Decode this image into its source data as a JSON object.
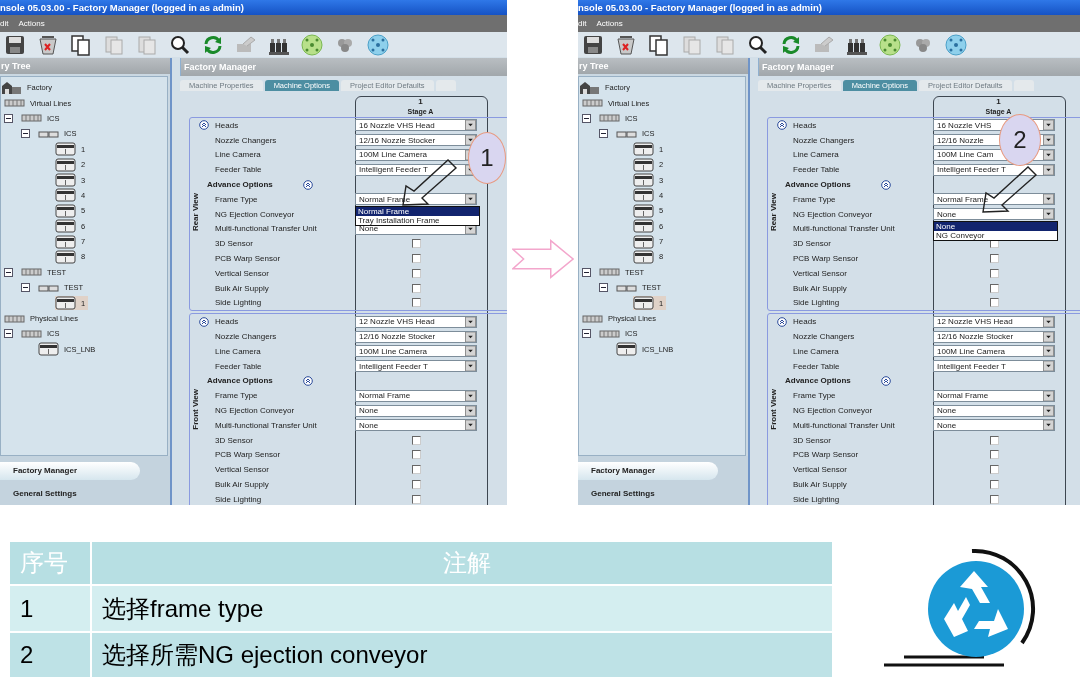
{
  "screens": [
    {
      "title": "nsole 05.03.00 - Factory Manager (logged in as admin)",
      "menu": [
        "dit",
        "Actions"
      ],
      "tree_title": "ry Tree",
      "tree": [
        {
          "label": "Factory",
          "selected": false,
          "children": [
            {
              "label": "Virtual Lines",
              "selected": false,
              "children": [
                {
                  "label": "ICS",
                  "selected": false,
                  "children": [
                    {
                      "label": "ICS",
                      "selected": false,
                      "children": [
                        {
                          "label": "1",
                          "selected": false
                        },
                        {
                          "label": "2",
                          "selected": false
                        },
                        {
                          "label": "3",
                          "selected": false
                        },
                        {
                          "label": "4",
                          "selected": false
                        },
                        {
                          "label": "5",
                          "selected": false
                        },
                        {
                          "label": "6",
                          "selected": false
                        },
                        {
                          "label": "7",
                          "selected": false
                        },
                        {
                          "label": "8",
                          "selected": false
                        }
                      ]
                    }
                  ]
                },
                {
                  "label": "TEST",
                  "selected": false,
                  "children": [
                    {
                      "label": "TEST",
                      "selected": false,
                      "children": [
                        {
                          "label": "1",
                          "selected": true
                        }
                      ]
                    }
                  ]
                }
              ]
            },
            {
              "label": "Physical Lines",
              "selected": false,
              "children": [
                {
                  "label": "ICS",
                  "selected": false,
                  "children": [
                    {
                      "label": "ICS_LNB",
                      "selected": false
                    }
                  ]
                }
              ]
            }
          ]
        }
      ],
      "nav": [
        {
          "label": "Factory Manager",
          "selected": true
        },
        {
          "label": "General Settings",
          "selected": false
        }
      ],
      "panel_title": "Factory Manager",
      "tabs": [
        {
          "label": "Machine Properties",
          "selected": false
        },
        {
          "label": "Machine Options",
          "selected": true
        },
        {
          "label": "Project Editor Defaults",
          "selected": false
        }
      ],
      "stage": {
        "number": "1",
        "name": "Stage A"
      },
      "groups": [
        {
          "label": "Rear View",
          "rows": [
            {
              "kind": "select",
              "label": "Heads",
              "value": "16 Nozzle VHS Head"
            },
            {
              "kind": "select",
              "label": "Nozzle Changers",
              "value": "12/16 Nozzle Stocker"
            },
            {
              "kind": "select",
              "label": "Line Camera",
              "value": "100M Line Camera"
            },
            {
              "kind": "select",
              "label": "Feeder Table",
              "value": "Intelligent Feeder T"
            },
            {
              "kind": "section",
              "label": "Advance Options"
            },
            {
              "kind": "select",
              "label": "Frame Type",
              "value": "Normal Frame",
              "popup": [
                {
                  "label": "Normal Frame",
                  "selected": true
                },
                {
                  "label": "Tray Installation Frame",
                  "selected": false
                }
              ]
            },
            {
              "kind": "select",
              "label": "NG Ejection Conveyor"
            },
            {
              "kind": "select",
              "label": "Multi-functional Transfer Unit",
              "value": "None"
            },
            {
              "kind": "check",
              "label": "3D Sensor",
              "checked": false
            },
            {
              "kind": "check",
              "label": "PCB Warp Sensor",
              "checked": false
            },
            {
              "kind": "check",
              "label": "Vertical Sensor",
              "checked": false
            },
            {
              "kind": "check",
              "label": "Bulk Air Supply",
              "checked": false
            },
            {
              "kind": "check",
              "label": "Side Lighting",
              "checked": false
            }
          ]
        },
        {
          "label": "Front View",
          "rows": [
            {
              "kind": "select",
              "label": "Heads",
              "value": "12 Nozzle VHS Head"
            },
            {
              "kind": "select",
              "label": "Nozzle Changers",
              "value": "12/16 Nozzle Stocker"
            },
            {
              "kind": "select",
              "label": "Line Camera",
              "value": "100M Line Camera"
            },
            {
              "kind": "select",
              "label": "Feeder Table",
              "value": "Intelligent Feeder T"
            },
            {
              "kind": "section",
              "label": "Advance Options"
            },
            {
              "kind": "select",
              "label": "Frame Type",
              "value": "Normal Frame"
            },
            {
              "kind": "select",
              "label": "NG Ejection Conveyor",
              "value": "None"
            },
            {
              "kind": "select",
              "label": "Multi-functional Transfer Unit",
              "value": "None"
            },
            {
              "kind": "check",
              "label": "3D Sensor",
              "checked": false
            },
            {
              "kind": "check",
              "label": "PCB Warp Sensor",
              "checked": false
            },
            {
              "kind": "check",
              "label": "Vertical Sensor",
              "checked": false
            },
            {
              "kind": "check",
              "label": "Bulk Air Supply",
              "checked": false
            },
            {
              "kind": "check",
              "label": "Side Lighting",
              "checked": false
            }
          ]
        }
      ],
      "callout": "1"
    },
    {
      "title": "nsole 05.03.00 - Factory Manager (logged in as admin)",
      "menu": [
        "dit",
        "Actions"
      ],
      "tree_title": "ry Tree",
      "tree": [
        {
          "label": "Factory",
          "selected": false,
          "children": [
            {
              "label": "Virtual Lines",
              "selected": false,
              "children": [
                {
                  "label": "ICS",
                  "selected": false,
                  "children": [
                    {
                      "label": "ICS",
                      "selected": false,
                      "children": [
                        {
                          "label": "1",
                          "selected": false
                        },
                        {
                          "label": "2",
                          "selected": false
                        },
                        {
                          "label": "3",
                          "selected": false
                        },
                        {
                          "label": "4",
                          "selected": false
                        },
                        {
                          "label": "5",
                          "selected": false
                        },
                        {
                          "label": "6",
                          "selected": false
                        },
                        {
                          "label": "7",
                          "selected": false
                        },
                        {
                          "label": "8",
                          "selected": false
                        }
                      ]
                    }
                  ]
                },
                {
                  "label": "TEST",
                  "selected": false,
                  "children": [
                    {
                      "label": "TEST",
                      "selected": false,
                      "children": [
                        {
                          "label": "1",
                          "selected": true
                        }
                      ]
                    }
                  ]
                }
              ]
            },
            {
              "label": "Physical Lines",
              "selected": false,
              "children": [
                {
                  "label": "ICS",
                  "selected": false,
                  "children": [
                    {
                      "label": "ICS_LNB",
                      "selected": false
                    }
                  ]
                }
              ]
            }
          ]
        }
      ],
      "nav": [
        {
          "label": "Factory Manager",
          "selected": true
        },
        {
          "label": "General Settings",
          "selected": false
        }
      ],
      "panel_title": "Factory Manager",
      "tabs": [
        {
          "label": "Machine Properties",
          "selected": false
        },
        {
          "label": "Machine Options",
          "selected": true
        },
        {
          "label": "Project Editor Defaults",
          "selected": false
        }
      ],
      "stage": {
        "number": "1",
        "name": "Stage A"
      },
      "groups": [
        {
          "label": "Rear View",
          "rows": [
            {
              "kind": "select",
              "label": "Heads",
              "value": "16 Nozzle VHS"
            },
            {
              "kind": "select",
              "label": "Nozzle Changers",
              "value": "12/16 Nozzle"
            },
            {
              "kind": "select",
              "label": "Line Camera",
              "value": "100M Line Cam"
            },
            {
              "kind": "select",
              "label": "Feeder Table",
              "value": "Intelligent Feeder T"
            },
            {
              "kind": "section",
              "label": "Advance Options"
            },
            {
              "kind": "select",
              "label": "Frame Type",
              "value": "Normal Frame"
            },
            {
              "kind": "select",
              "label": "NG Ejection Conveyor",
              "value": "None",
              "popup": [
                {
                  "label": "None",
                  "selected": true
                },
                {
                  "label": "NG Conveyor",
                  "selected": false
                }
              ]
            },
            {
              "kind": "select",
              "label": "Multi-functional Transfer Unit"
            },
            {
              "kind": "check",
              "label": "3D Sensor",
              "checked": false
            },
            {
              "kind": "check",
              "label": "PCB Warp Sensor",
              "checked": false
            },
            {
              "kind": "check",
              "label": "Vertical Sensor",
              "checked": false
            },
            {
              "kind": "check",
              "label": "Bulk Air Supply",
              "checked": false
            },
            {
              "kind": "check",
              "label": "Side Lighting",
              "checked": false
            }
          ]
        },
        {
          "label": "Front View",
          "rows": [
            {
              "kind": "select",
              "label": "Heads",
              "value": "12 Nozzle VHS Head"
            },
            {
              "kind": "select",
              "label": "Nozzle Changers",
              "value": "12/16 Nozzle Stocker"
            },
            {
              "kind": "select",
              "label": "Line Camera",
              "value": "100M Line Camera"
            },
            {
              "kind": "select",
              "label": "Feeder Table",
              "value": "Intelligent Feeder T"
            },
            {
              "kind": "section",
              "label": "Advance Options"
            },
            {
              "kind": "select",
              "label": "Frame Type",
              "value": "Normal Frame"
            },
            {
              "kind": "select",
              "label": "NG Ejection Conveyor",
              "value": "None"
            },
            {
              "kind": "select",
              "label": "Multi-functional Transfer Unit",
              "value": "None"
            },
            {
              "kind": "check",
              "label": "3D Sensor",
              "checked": false
            },
            {
              "kind": "check",
              "label": "PCB Warp Sensor",
              "checked": false
            },
            {
              "kind": "check",
              "label": "Vertical Sensor",
              "checked": false
            },
            {
              "kind": "check",
              "label": "Bulk Air Supply",
              "checked": false
            },
            {
              "kind": "check",
              "label": "Side Lighting",
              "checked": false
            }
          ]
        }
      ],
      "callout": "2"
    }
  ],
  "table": {
    "columns": [
      "序号",
      "注解"
    ],
    "rows": [
      [
        "1",
        "选择frame type"
      ],
      [
        "2",
        "选择所需NG ejection conveyor"
      ]
    ]
  }
}
